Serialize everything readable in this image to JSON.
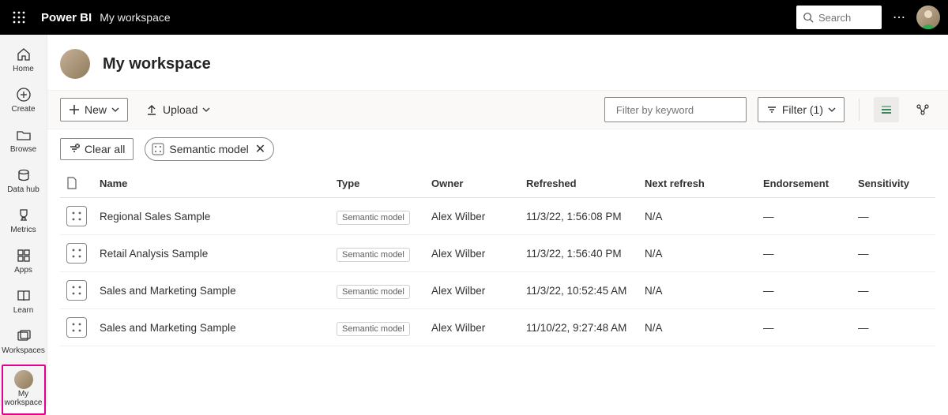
{
  "topbar": {
    "brand": "Power BI",
    "breadcrumb": "My workspace",
    "search_placeholder": "Search"
  },
  "nav": {
    "items": [
      {
        "id": "home",
        "label": "Home"
      },
      {
        "id": "create",
        "label": "Create"
      },
      {
        "id": "browse",
        "label": "Browse"
      },
      {
        "id": "datahub",
        "label": "Data hub"
      },
      {
        "id": "metrics",
        "label": "Metrics"
      },
      {
        "id": "apps",
        "label": "Apps"
      },
      {
        "id": "learn",
        "label": "Learn"
      },
      {
        "id": "workspaces",
        "label": "Workspaces"
      },
      {
        "id": "myws",
        "label": "My workspace"
      }
    ]
  },
  "workspace": {
    "title": "My workspace"
  },
  "toolbar": {
    "new_label": "New",
    "upload_label": "Upload",
    "filter_placeholder": "Filter by keyword",
    "filter_btn": "Filter (1)"
  },
  "chips": {
    "clear_all": "Clear all",
    "items": [
      {
        "id": "semantic-model",
        "label": "Semantic model"
      }
    ]
  },
  "table": {
    "headers": {
      "name": "Name",
      "type": "Type",
      "owner": "Owner",
      "refreshed": "Refreshed",
      "next": "Next refresh",
      "endorsement": "Endorsement",
      "sensitivity": "Sensitivity"
    },
    "rows": [
      {
        "name": "Regional Sales Sample",
        "type": "Semantic model",
        "owner": "Alex Wilber",
        "refreshed": "11/3/22, 1:56:08 PM",
        "next": "N/A",
        "endorsement": "—",
        "sensitivity": "—"
      },
      {
        "name": "Retail Analysis Sample",
        "type": "Semantic model",
        "owner": "Alex Wilber",
        "refreshed": "11/3/22, 1:56:40 PM",
        "next": "N/A",
        "endorsement": "—",
        "sensitivity": "—"
      },
      {
        "name": "Sales and Marketing Sample",
        "type": "Semantic model",
        "owner": "Alex Wilber",
        "refreshed": "11/3/22, 10:52:45 AM",
        "next": "N/A",
        "endorsement": "—",
        "sensitivity": "—"
      },
      {
        "name": "Sales and Marketing Sample",
        "type": "Semantic model",
        "owner": "Alex Wilber",
        "refreshed": "11/10/22, 9:27:48 AM",
        "next": "N/A",
        "endorsement": "—",
        "sensitivity": "—"
      }
    ]
  }
}
